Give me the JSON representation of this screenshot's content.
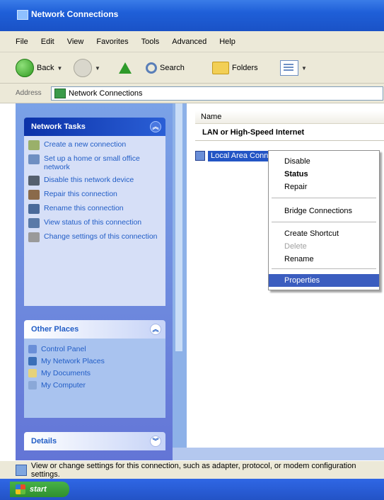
{
  "window": {
    "title": "Network Connections"
  },
  "menu": [
    "File",
    "Edit",
    "View",
    "Favorites",
    "Tools",
    "Advanced",
    "Help"
  ],
  "toolbar": {
    "back": "Back",
    "search": "Search",
    "folders": "Folders"
  },
  "address": {
    "label": "Address",
    "value": "Network Connections"
  },
  "network_tasks": {
    "title": "Network Tasks",
    "items": [
      "Create a new connection",
      "Set up a home or small office network",
      "Disable this network device",
      "Repair this connection",
      "Rename this connection",
      "View status of this connection",
      "Change settings of this connection"
    ]
  },
  "other_places": {
    "title": "Other Places",
    "items": [
      "Control Panel",
      "My Network Places",
      "My Documents",
      "My Computer"
    ]
  },
  "details": {
    "title": "Details"
  },
  "list": {
    "column_name": "Name",
    "group": "LAN or High-Speed Internet",
    "selected_item": "Local Area Connection"
  },
  "context_menu": {
    "items": [
      "Disable",
      "Status",
      "Repair",
      "Bridge Connections",
      "Create Shortcut",
      "Delete",
      "Rename",
      "Properties"
    ]
  },
  "status_bar": {
    "text": "View or change settings for this connection, such as adapter, protocol, or modem configuration settings."
  },
  "taskbar": {
    "start": "start"
  }
}
